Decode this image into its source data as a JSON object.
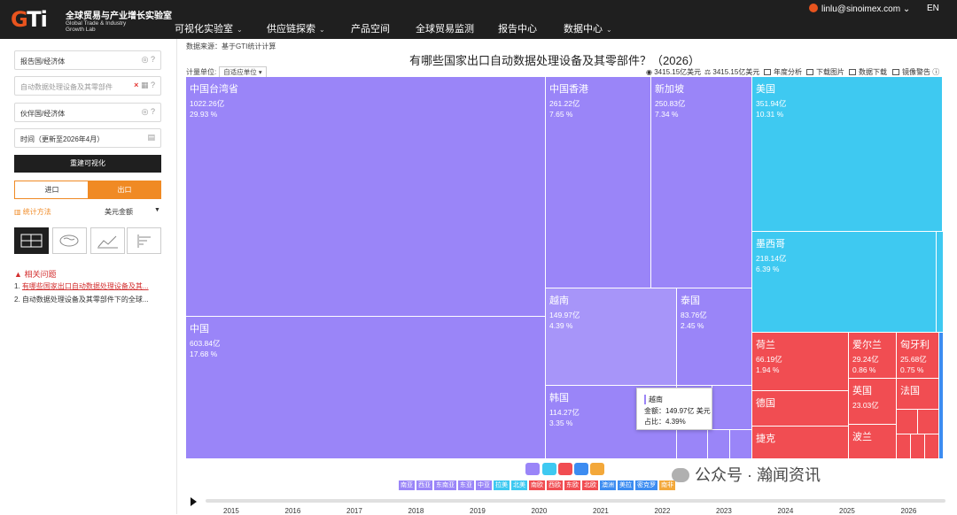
{
  "nav": {
    "logo_mark": "GTi",
    "logo_cn": "全球贸易与产业增长实验室",
    "logo_en": "Global Trade & Industry Growth Lab",
    "items": [
      {
        "label": "可视化实验室",
        "dropdown": true
      },
      {
        "label": "供应链探索",
        "dropdown": true
      },
      {
        "label": "产品空间",
        "dropdown": false
      },
      {
        "label": "全球贸易监测",
        "dropdown": false
      },
      {
        "label": "报告中心",
        "dropdown": false
      },
      {
        "label": "数据中心",
        "dropdown": true
      }
    ],
    "user": "linlu@sinoimex.com",
    "lang": "EN"
  },
  "sidebar": {
    "reporter_placeholder": "报告国/经济体",
    "product_value": "自动数据处理设备及其零部件",
    "partner_placeholder": "伙伴国/经济体",
    "time_value": "时间（更新至2026年4月）",
    "rebuild_label": "重建可视化",
    "import_label": "进口",
    "export_label": "出口",
    "method_label": "统计方法",
    "method_value": "美元金额",
    "questions_title": "相关问题",
    "questions": [
      "有哪些国家出口自动数据处理设备及其...",
      "自动数据处理设备及其零部件下的全球..."
    ]
  },
  "main": {
    "source": "数据来源：基于GTI统计计算",
    "title": "有哪些国家出口自动数据处理设备及其零部件？（2026）",
    "unit_label": "计量单位:",
    "unit_value": "自适应单位",
    "tools": [
      "3415.15亿美元",
      "3415.15亿美元",
      "年度分析",
      "下载图片",
      "数据下载",
      "镜像警告"
    ]
  },
  "chart_data": {
    "type": "treemap",
    "title": "有哪些国家出口自动数据处理设备及其零部件？（2026）",
    "total": "3415.15亿美元",
    "tiles": [
      {
        "name": "中国台湾省",
        "value": "1022.26亿",
        "share": "29.93 %",
        "color": "#9a85f8"
      },
      {
        "name": "中国",
        "value": "603.84亿",
        "share": "17.68 %",
        "color": "#9a85f8"
      },
      {
        "name": "中国香港",
        "value": "261.22亿",
        "share": "7.65 %",
        "color": "#9a85f8"
      },
      {
        "name": "新加坡",
        "value": "250.83亿",
        "share": "7.34 %",
        "color": "#9a85f8"
      },
      {
        "name": "越南",
        "value": "149.97亿",
        "share": "4.39 %",
        "color": "#a795f9"
      },
      {
        "name": "泰国",
        "value": "83.76亿",
        "share": "2.45 %",
        "color": "#9a85f8"
      },
      {
        "name": "韩国",
        "value": "114.27亿",
        "share": "3.35 %",
        "color": "#9a85f8"
      },
      {
        "name": "美国",
        "value": "351.94亿",
        "share": "10.31 %",
        "color": "#3ec9f1"
      },
      {
        "name": "墨西哥",
        "value": "218.14亿",
        "share": "6.39 %",
        "color": "#3ec9f1"
      },
      {
        "name": "荷兰",
        "value": "66.19亿",
        "share": "1.94 %",
        "color": "#f14d52"
      },
      {
        "name": "爱尔兰",
        "value": "29.24亿",
        "share": "0.86 %",
        "color": "#f14d52"
      },
      {
        "name": "匈牙利",
        "value": "25.68亿",
        "share": "0.75 %",
        "color": "#f14d52"
      },
      {
        "name": "德国",
        "value": "",
        "share": "",
        "color": "#f14d52"
      },
      {
        "name": "英国",
        "value": "23.03亿",
        "share": "",
        "color": "#f14d52"
      },
      {
        "name": "法国",
        "value": "",
        "share": "",
        "color": "#f14d52"
      },
      {
        "name": "捷克",
        "value": "",
        "share": "",
        "color": "#f14d52"
      },
      {
        "name": "波兰",
        "value": "",
        "share": "",
        "color": "#f14d52"
      }
    ],
    "tooltip": {
      "name": "越南",
      "amount": "金额：149.97亿 美元",
      "share": "占比：4.39%"
    },
    "legend": [
      {
        "label": "南亚",
        "color": "#9a85f8"
      },
      {
        "label": "西亚",
        "color": "#9a85f8"
      },
      {
        "label": "东南亚",
        "color": "#9a85f8"
      },
      {
        "label": "东亚",
        "color": "#9a85f8"
      },
      {
        "label": "中亚",
        "color": "#9a85f8"
      },
      {
        "label": "拉美",
        "color": "#3ec9f1"
      },
      {
        "label": "北美",
        "color": "#3ec9f1"
      },
      {
        "label": "南欧",
        "color": "#f14d52"
      },
      {
        "label": "西欧",
        "color": "#f14d52"
      },
      {
        "label": "东欧",
        "color": "#f14d52"
      },
      {
        "label": "北欧",
        "color": "#f14d52"
      },
      {
        "label": "澳洲",
        "color": "#3c8cf1"
      },
      {
        "label": "美拉",
        "color": "#3c8cf1"
      },
      {
        "label": "密克罗",
        "color": "#3c8cf1"
      },
      {
        "label": "南非",
        "color": "#f3a83a"
      }
    ],
    "years": [
      "2015",
      "2016",
      "2017",
      "2018",
      "2019",
      "2020",
      "2021",
      "2022",
      "2023",
      "2024",
      "2025",
      "2026"
    ]
  },
  "watermark": "公众号 · 瀚闻资讯"
}
